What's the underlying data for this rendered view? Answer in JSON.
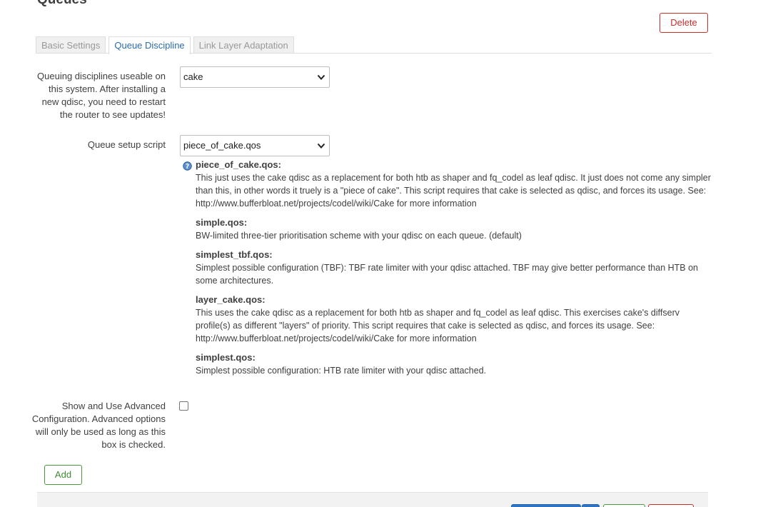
{
  "section": {
    "title": "Queues"
  },
  "actions": {
    "delete_label": "Delete",
    "add_label": "Add"
  },
  "tabs": [
    {
      "label": "Basic Settings",
      "active": false
    },
    {
      "label": "Queue Discipline",
      "active": true
    },
    {
      "label": "Link Layer Adaptation",
      "active": false
    }
  ],
  "fields": {
    "qdisc": {
      "label": "Queuing disciplines useable on this system. After installing a new qdisc, you need to restart the router to see updates!",
      "value": "cake"
    },
    "script": {
      "label": "Queue setup script",
      "value": "piece_of_cake.qos"
    },
    "advanced": {
      "label": "Show and Use Advanced Configuration. Advanced options will only be used as long as this box is checked.",
      "checked": false
    }
  },
  "help": [
    {
      "title": "piece_of_cake.qos:",
      "description": "This just uses the cake qdisc as a replacement for both htb as shaper and fq_codel as leaf qdisc. It just does not come any simpler than this, in other words it truely is a \"piece of cake\". This script requires that cake is selected as qdisc, and forces its usage. See: http://www.bufferbloat.net/projects/codel/wiki/Cake for more information"
    },
    {
      "title": "simple.qos:",
      "description": "BW-limited three-tier prioritisation scheme with your qdisc on each queue. (default)"
    },
    {
      "title": "simplest_tbf.qos:",
      "description": "Simplest possible configuration (TBF): TBF rate limiter with your qdisc attached. TBF may give better performance than HTB on some architectures."
    },
    {
      "title": "layer_cake.qos:",
      "description": "This uses the cake qdisc as a replacement for both htb as shaper and fq_codel as leaf qdisc. This exercises cake's diffserv profile(s) as different \"layers\" of priority. This script requires that cake is selected as qdisc, and forces its usage. See: http://www.bufferbloat.net/projects/codel/wiki/Cake for more information"
    },
    {
      "title": "simplest.qos:",
      "description": "Simplest possible configuration: HTB rate limiter with your qdisc attached."
    }
  ],
  "icons": {
    "help": "help-icon",
    "dropdown": "chevron-down-icon"
  },
  "colors": {
    "accent": "#2b6cb0",
    "danger": "#c9302c",
    "success": "#4a9a3c",
    "primary": "#2f73c2"
  }
}
